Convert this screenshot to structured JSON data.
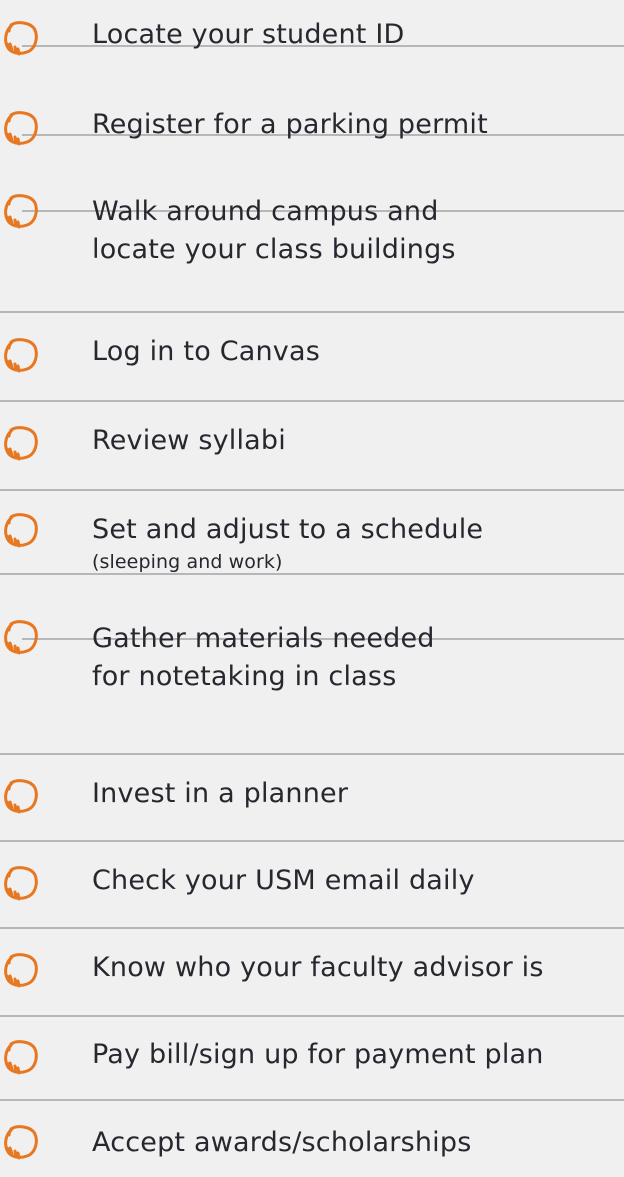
{
  "checklist": {
    "items": [
      {
        "text": "Locate your student ID"
      },
      {
        "text": "Register for a parking permit"
      },
      {
        "line1": "Walk around campus and",
        "line2": "locate your class buildings"
      },
      {
        "text": "Log in to Canvas"
      },
      {
        "text": "Review syllabi"
      },
      {
        "text": "Set and adjust to a schedule",
        "subtext": "(sleeping and work)"
      },
      {
        "line1": "Gather materials needed",
        "line2": "for notetaking in class"
      },
      {
        "text": "Invest in a planner"
      },
      {
        "text": "Check your USM email daily"
      },
      {
        "text": "Know who your faculty advisor is"
      },
      {
        "text": "Pay bill/sign up for payment plan"
      },
      {
        "text": "Accept awards/scholarships"
      }
    ]
  },
  "colors": {
    "checkbox_stroke": "#e87722",
    "rule": "#b7b7b7",
    "text": "#27272f",
    "background": "#f0f0f0"
  },
  "icons": {
    "checkbox": "hand-drawn-checkbox-icon"
  }
}
